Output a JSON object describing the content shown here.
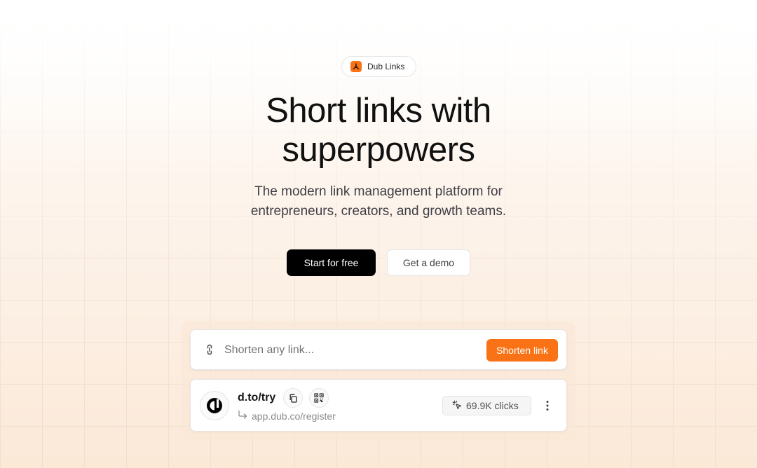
{
  "badge": {
    "label": "Dub Links",
    "icon": "dub-logo-icon"
  },
  "hero": {
    "title_line1": "Short links with",
    "title_line2": "superpowers",
    "subtitle_line1": "The modern link management platform for",
    "subtitle_line2": "entrepreneurs, creators, and growth teams."
  },
  "cta": {
    "primary_label": "Start for free",
    "secondary_label": "Get a demo"
  },
  "shortener": {
    "placeholder": "Shorten any link...",
    "value": "",
    "button_label": "Shorten link",
    "icon": "link-icon"
  },
  "link_card": {
    "short_link": "d.to/try",
    "destination": "app.dub.co/register",
    "clicks": "69.9K clicks",
    "icons": [
      "dub-avatar-icon",
      "copy-icon",
      "qr-code-icon",
      "redirect-arrow-icon",
      "cursor-click-icon",
      "more-vertical-icon"
    ]
  },
  "colors": {
    "accent": "#f97316",
    "primary_button": "#000000",
    "background_tint": "#fbe9d8"
  }
}
